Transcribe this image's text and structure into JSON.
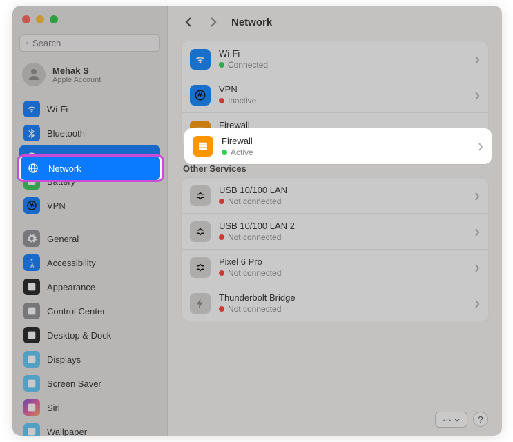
{
  "window": {
    "title": "Network"
  },
  "search": {
    "placeholder": "Search"
  },
  "account": {
    "name": "Mehak S",
    "subtitle": "Apple Account"
  },
  "sidebar": {
    "items": [
      {
        "label": "Wi-Fi",
        "icon": "wifi",
        "bg": "ic-blue"
      },
      {
        "label": "Bluetooth",
        "icon": "bluetooth",
        "bg": "ic-blue"
      },
      {
        "label": "Network",
        "icon": "globe",
        "bg": "ic-blue",
        "selected": true
      },
      {
        "label": "Battery",
        "icon": "battery",
        "bg": "ic-green"
      },
      {
        "label": "VPN",
        "icon": "vpn",
        "bg": "ic-blue"
      },
      {
        "label": "General",
        "icon": "gear",
        "bg": "ic-gray"
      },
      {
        "label": "Accessibility",
        "icon": "accessibility",
        "bg": "ic-blue"
      },
      {
        "label": "Appearance",
        "icon": "appearance",
        "bg": "ic-black"
      },
      {
        "label": "Control Center",
        "icon": "control",
        "bg": "ic-gray"
      },
      {
        "label": "Desktop & Dock",
        "icon": "dock",
        "bg": "ic-black"
      },
      {
        "label": "Displays",
        "icon": "display",
        "bg": "ic-lblue"
      },
      {
        "label": "Screen Saver",
        "icon": "screensaver",
        "bg": "ic-lblue"
      },
      {
        "label": "Siri",
        "icon": "siri",
        "bg": "ic-grad"
      },
      {
        "label": "Wallpaper",
        "icon": "wallpaper",
        "bg": "ic-lblue"
      }
    ]
  },
  "network": {
    "primary": [
      {
        "title": "Wi-Fi",
        "status": "Connected",
        "dot": "g",
        "icon": "wifi",
        "bg": "ic-teal"
      },
      {
        "title": "VPN",
        "status": "Inactive",
        "dot": "r",
        "icon": "vpn",
        "bg": "ic-teal"
      },
      {
        "title": "Firewall",
        "status": "Active",
        "dot": "g",
        "icon": "firewall",
        "bg": "ic-orange"
      }
    ],
    "other_heading": "Other Services",
    "other": [
      {
        "title": "USB 10/100 LAN",
        "status": "Not connected",
        "dot": "r",
        "icon": "eth"
      },
      {
        "title": "USB 10/100 LAN 2",
        "status": "Not connected",
        "dot": "r",
        "icon": "eth"
      },
      {
        "title": "Pixel 6 Pro",
        "status": "Not connected",
        "dot": "r",
        "icon": "eth"
      },
      {
        "title": "Thunderbolt Bridge",
        "status": "Not connected",
        "dot": "r",
        "icon": "bolt"
      }
    ]
  },
  "footer": {
    "more": "···",
    "help": "?"
  }
}
